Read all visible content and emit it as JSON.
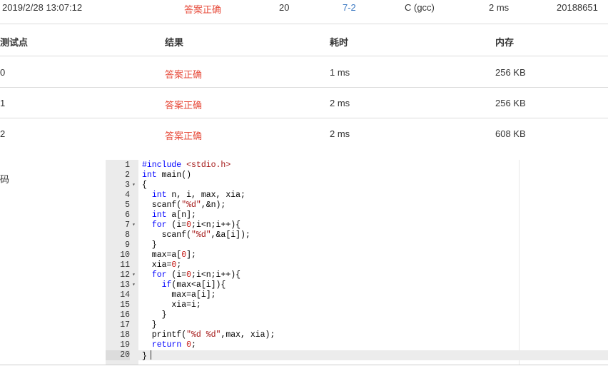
{
  "summary": {
    "time": "2019/2/28 13:07:12",
    "status": "答案正确",
    "score": "20",
    "problem": "7-2",
    "compiler": "C (gcc)",
    "duration": "2 ms",
    "user": "20188651"
  },
  "table": {
    "headers": [
      "测试点",
      "结果",
      "耗时",
      "内存"
    ],
    "rows": [
      {
        "id": "0",
        "result": "答案正确",
        "time": "1 ms",
        "memory": "256 KB"
      },
      {
        "id": "1",
        "result": "答案正确",
        "time": "2 ms",
        "memory": "256 KB"
      },
      {
        "id": "2",
        "result": "答案正确",
        "time": "2 ms",
        "memory": "608 KB"
      }
    ]
  },
  "code_label": "码",
  "colors": {
    "status_red": "#e74c3c",
    "link_blue": "#3a78c2",
    "keyword_blue": "#0000ff",
    "string_red": "#a31515",
    "number_red": "#c41a16"
  },
  "editor": {
    "lines": [
      {
        "n": "1",
        "text": "#include <stdio.h>",
        "fold": ""
      },
      {
        "n": "2",
        "text": "int main()",
        "fold": ""
      },
      {
        "n": "3",
        "text": "{",
        "fold": "▾"
      },
      {
        "n": "4",
        "text": "  int n, i, max, xia;",
        "fold": ""
      },
      {
        "n": "5",
        "text": "  scanf(\"%d\",&n);",
        "fold": ""
      },
      {
        "n": "6",
        "text": "  int a[n];",
        "fold": ""
      },
      {
        "n": "7",
        "text": "  for (i=0;i<n;i++){",
        "fold": "▾"
      },
      {
        "n": "8",
        "text": "    scanf(\"%d\",&a[i]);",
        "fold": ""
      },
      {
        "n": "9",
        "text": "  }",
        "fold": ""
      },
      {
        "n": "10",
        "text": "  max=a[0];",
        "fold": ""
      },
      {
        "n": "11",
        "text": "  xia=0;",
        "fold": ""
      },
      {
        "n": "12",
        "text": "  for (i=0;i<n;i++){",
        "fold": "▾"
      },
      {
        "n": "13",
        "text": "    if(max<a[i]){",
        "fold": "▾"
      },
      {
        "n": "14",
        "text": "      max=a[i];",
        "fold": ""
      },
      {
        "n": "15",
        "text": "      xia=i;",
        "fold": ""
      },
      {
        "n": "16",
        "text": "    }",
        "fold": ""
      },
      {
        "n": "17",
        "text": "  }",
        "fold": ""
      },
      {
        "n": "18",
        "text": "  printf(\"%d %d\",max, xia);",
        "fold": ""
      },
      {
        "n": "19",
        "text": "  return 0;",
        "fold": ""
      },
      {
        "n": "20",
        "text": "}",
        "fold": ""
      }
    ],
    "active_line": "20"
  }
}
